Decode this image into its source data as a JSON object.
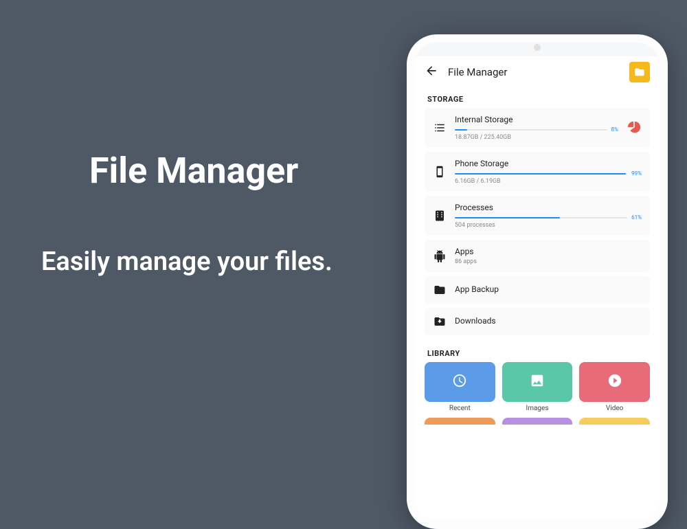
{
  "promo": {
    "title": "File Manager",
    "subtitle": "Easily manage your files."
  },
  "app": {
    "title": "File Manager",
    "section_storage": "STORAGE",
    "section_library": "LIBRARY"
  },
  "storage": [
    {
      "title": "Internal Storage",
      "sub": "18.87GB / 225.40GB",
      "pct": "8%",
      "pct_width": 8,
      "has_pie": true
    },
    {
      "title": "Phone Storage",
      "sub": "6.16GB / 6.19GB",
      "pct": "99%",
      "pct_width": 99,
      "has_pie": false
    },
    {
      "title": "Processes",
      "sub": "504 processes",
      "pct": "61%",
      "pct_width": 61,
      "has_pie": false
    },
    {
      "title": "Apps",
      "sub": "86 apps"
    },
    {
      "title": "App Backup"
    },
    {
      "title": "Downloads"
    }
  ],
  "library": [
    {
      "label": "Recent",
      "color": "#5b9be8"
    },
    {
      "label": "Images",
      "color": "#5ac7a8"
    },
    {
      "label": "Video",
      "color": "#e86b7a"
    }
  ],
  "library_next_row_colors": [
    "#f09a5a",
    "#b890e0",
    "#f5cd5e"
  ]
}
